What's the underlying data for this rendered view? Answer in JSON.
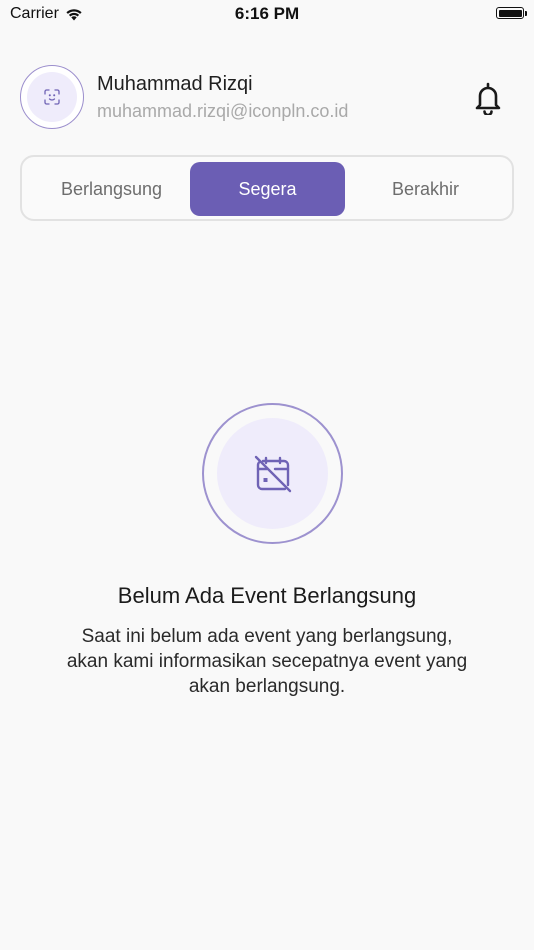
{
  "status_bar": {
    "carrier": "Carrier",
    "time": "6:16 PM"
  },
  "header": {
    "user_name": "Muhammad Rizqi",
    "user_email": "muhammad.rizqi@iconpln.co.id",
    "avatar_icon": "scan-face-icon",
    "notification_icon": "bell-icon"
  },
  "tabs": [
    {
      "label": "Berlangsung",
      "selected": false
    },
    {
      "label": "Segera",
      "selected": true
    },
    {
      "label": "Berakhir",
      "selected": false
    }
  ],
  "empty_state": {
    "icon": "calendar-off-icon",
    "title": "Belum Ada Event Berlangsung",
    "description": "Saat ini belum ada event yang berlangsung, akan kami informasikan secepatnya event yang akan berlangsung."
  },
  "colors": {
    "accent": "#6b5eb4",
    "accent_light": "#efecfb",
    "ring": "#9d92cf",
    "icon": "#6f63b5"
  }
}
